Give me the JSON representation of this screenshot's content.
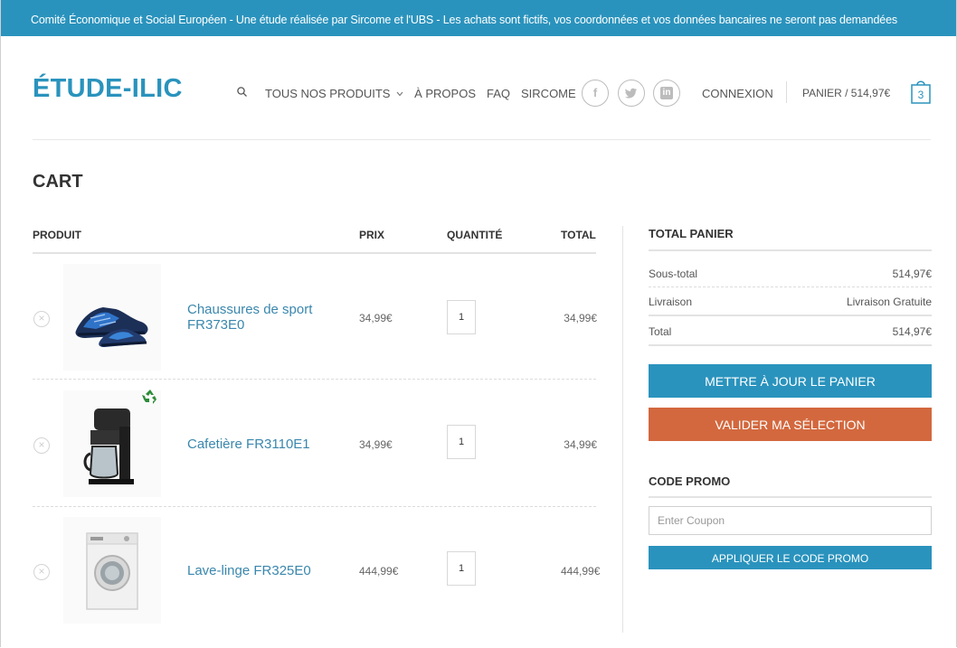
{
  "banner": "Comité Économique et Social Européen - Une étude réalisée par Sircome et l'UBS - Les achats sont fictifs, vos coordonnées et vos données bancaires ne seront pas demandées",
  "logo": "ÉTUDE-ILIC",
  "nav": {
    "products": "TOUS NOS PRODUITS",
    "about": "À PROPOS",
    "faq": "FAQ",
    "sircome": "SIRCOME",
    "login": "CONNEXION",
    "cart": "PANIER / 514,97€",
    "cart_count": "3",
    "social": [
      {
        "icon": "facebook-icon",
        "glyph": "f"
      },
      {
        "icon": "twitter-icon",
        "glyph": "t"
      },
      {
        "icon": "linkedin-icon",
        "glyph": "in"
      }
    ]
  },
  "page_title": "CART",
  "table": {
    "headers": {
      "product": "PRODUIT",
      "price": "PRIX",
      "quantity": "QUANTITÉ",
      "total": "TOTAL"
    },
    "rows": [
      {
        "name_line1": "Chaussures de sport",
        "name_line2": "FR373E0",
        "price": "34,99€",
        "qty": "1",
        "total": "34,99€",
        "image": "sneakers",
        "eco_badge": false
      },
      {
        "name_line1": "Cafetière FR3110E1",
        "name_line2": "",
        "price": "34,99€",
        "qty": "1",
        "total": "34,99€",
        "image": "coffee-maker",
        "eco_badge": true
      },
      {
        "name_line1": "Lave-linge FR325E0",
        "name_line2": "",
        "price": "444,99€",
        "qty": "1",
        "total": "444,99€",
        "image": "washing-machine",
        "eco_badge": false
      }
    ]
  },
  "summary": {
    "title": "TOTAL PANIER",
    "subtotal_label": "Sous-total",
    "subtotal_value": "514,97€",
    "shipping_label": "Livraison",
    "shipping_value": "Livraison Gratuite",
    "total_label": "Total",
    "total_value": "514,97€",
    "update_button": "METTRE À JOUR LE PANIER",
    "checkout_button": "VALIDER MA SÉLECTION",
    "promo_title": "CODE PROMO",
    "coupon_placeholder": "Enter Coupon",
    "apply_button": "APPLIQUER LE CODE PROMO"
  },
  "colors": {
    "accent": "#2a93bd",
    "checkout": "#d3683e",
    "eco": "#2e8b3a"
  }
}
